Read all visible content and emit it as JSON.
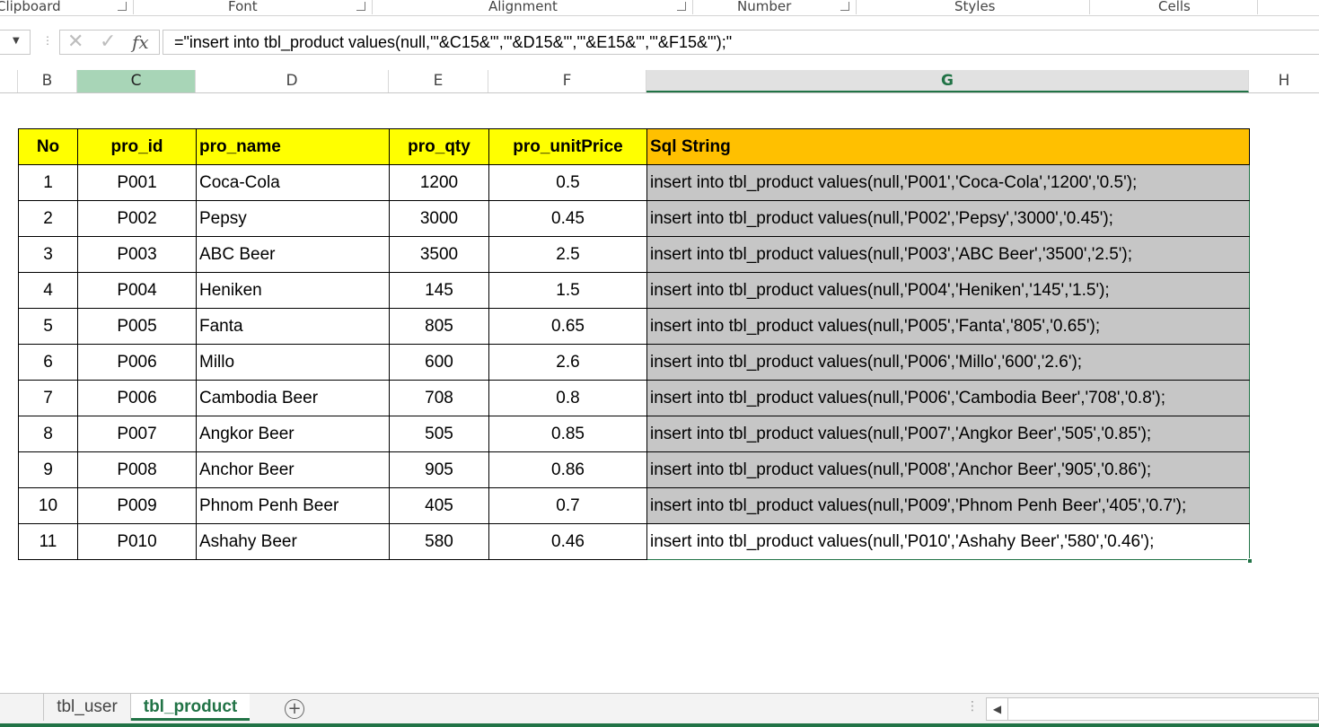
{
  "ribbon": {
    "groups": [
      "Clipboard",
      "Font",
      "Alignment",
      "Number",
      "Styles",
      "Cells"
    ]
  },
  "formula_bar": {
    "formula": "=\"insert into tbl_product values(null,'\"&C15&\"','\"&D15&\"','\"&E15&\"','\"&F15&\"');\"",
    "fx_label": "fx"
  },
  "columns": [
    "B",
    "C",
    "D",
    "E",
    "F",
    "G",
    "H"
  ],
  "table": {
    "headers": [
      "No",
      "pro_id",
      "pro_name",
      "pro_qty",
      "pro_unitPrice",
      "Sql String"
    ],
    "rows": [
      [
        "1",
        "P001",
        "Coca-Cola",
        "1200",
        "0.5",
        "insert into tbl_product values(null,'P001','Coca-Cola','1200','0.5');"
      ],
      [
        "2",
        "P002",
        "Pepsy",
        "3000",
        "0.45",
        "insert into tbl_product values(null,'P002','Pepsy','3000','0.45');"
      ],
      [
        "3",
        "P003",
        "ABC Beer",
        "3500",
        "2.5",
        "insert into tbl_product values(null,'P003','ABC Beer','3500','2.5');"
      ],
      [
        "4",
        "P004",
        "Heniken",
        "145",
        "1.5",
        "insert into tbl_product values(null,'P004','Heniken','145','1.5');"
      ],
      [
        "5",
        "P005",
        "Fanta",
        "805",
        "0.65",
        "insert into tbl_product values(null,'P005','Fanta','805','0.65');"
      ],
      [
        "6",
        "P006",
        "Millo",
        "600",
        "2.6",
        "insert into tbl_product values(null,'P006','Millo','600','2.6');"
      ],
      [
        "7",
        "P006",
        "Cambodia Beer",
        "708",
        "0.8",
        "insert into tbl_product values(null,'P006','Cambodia Beer','708','0.8');"
      ],
      [
        "8",
        "P007",
        "Angkor Beer",
        "505",
        "0.85",
        "insert into tbl_product values(null,'P007','Angkor Beer','505','0.85');"
      ],
      [
        "9",
        "P008",
        "Anchor Beer",
        "905",
        "0.86",
        "insert into tbl_product values(null,'P008','Anchor Beer','905','0.86');"
      ],
      [
        "10",
        "P009",
        "Phnom Penh Beer",
        "405",
        "0.7",
        "insert into tbl_product values(null,'P009','Phnom Penh Beer','405','0.7');"
      ],
      [
        "11",
        "P010",
        "Ashahy Beer",
        "580",
        "0.46",
        "insert into tbl_product values(null,'P010','Ashahy Beer','580','0.46');"
      ]
    ]
  },
  "sheet_tabs": {
    "tabs": [
      "tbl_user",
      "tbl_product"
    ],
    "active": "tbl_product",
    "add_label": "+"
  },
  "colors": {
    "header_yellow": "#ffff00",
    "header_orange": "#ffc000",
    "selection_gray": "#c6c6c6",
    "excel_green": "#217346"
  }
}
